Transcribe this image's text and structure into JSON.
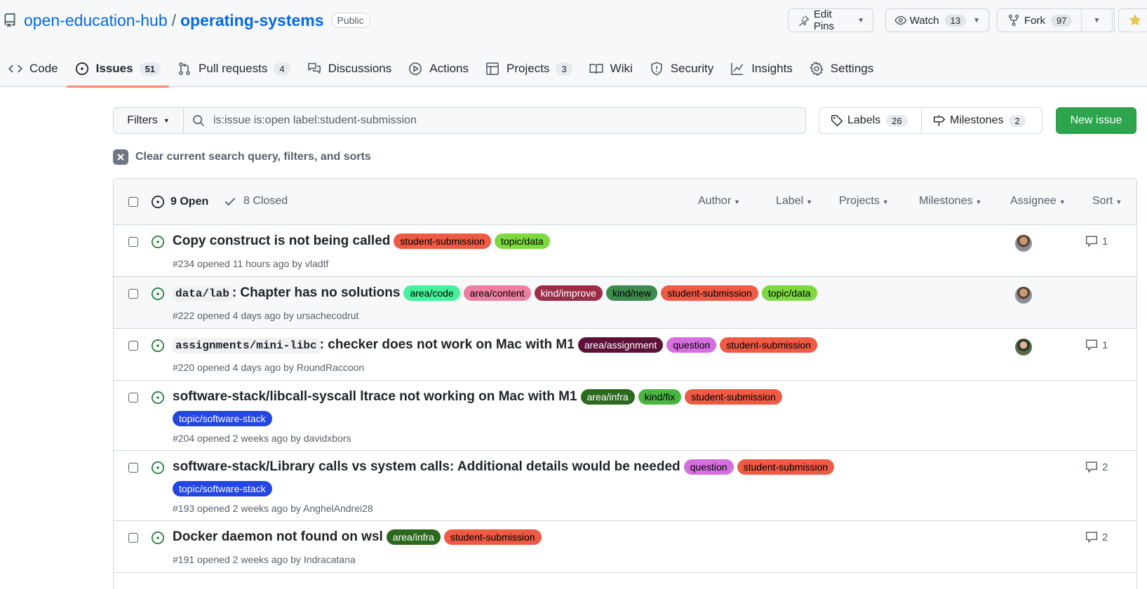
{
  "repo": {
    "owner": "open-education-hub",
    "separator": "/",
    "name": "operating-systems",
    "visibility": "Public"
  },
  "header_buttons": {
    "edit_pins": "Edit Pins",
    "watch": "Watch",
    "watch_count": "13",
    "fork": "Fork",
    "fork_count": "97"
  },
  "tabs": [
    {
      "label": "Code",
      "icon": "code-icon"
    },
    {
      "label": "Issues",
      "count": "51",
      "icon": "issue-opened-icon",
      "active": true
    },
    {
      "label": "Pull requests",
      "count": "4",
      "icon": "git-pull-request-icon"
    },
    {
      "label": "Discussions",
      "icon": "comment-discussion-icon"
    },
    {
      "label": "Actions",
      "icon": "play-icon"
    },
    {
      "label": "Projects",
      "count": "3",
      "icon": "table-icon"
    },
    {
      "label": "Wiki",
      "icon": "book-icon"
    },
    {
      "label": "Security",
      "icon": "shield-icon"
    },
    {
      "label": "Insights",
      "icon": "graph-icon"
    },
    {
      "label": "Settings",
      "icon": "gear-icon"
    }
  ],
  "filter_bar": {
    "filters_label": "Filters",
    "search_value": "is:issue is:open label:student-submission",
    "labels_label": "Labels",
    "labels_count": "26",
    "milestones_label": "Milestones",
    "milestones_count": "2",
    "new_issue_label": "New issue"
  },
  "clear_query": "Clear current search query, filters, and sorts",
  "list_header": {
    "open_label": "9 Open",
    "closed_label": "8 Closed",
    "filters": [
      "Author",
      "Label",
      "Projects",
      "Milestones",
      "Assignee",
      "Sort"
    ]
  },
  "issues": [
    {
      "title_code": "",
      "title": "Copy construct is not being called",
      "labels": [
        {
          "name": "student-submission",
          "bg": "#ee5a44",
          "fg": "#000000"
        },
        {
          "name": "topic/data",
          "bg": "#7ed941",
          "fg": "#000000"
        }
      ],
      "meta": "#234 opened 11 hours ago by vladtf",
      "comments": "1",
      "has_avatar": true
    },
    {
      "title_code": "data/lab",
      "title": ": Chapter has no solutions",
      "labels": [
        {
          "name": "area/code",
          "bg": "#45f29b",
          "fg": "#000000"
        },
        {
          "name": "area/content",
          "bg": "#ee7fa0",
          "fg": "#000000"
        },
        {
          "name": "kind/improve",
          "bg": "#9b2d49",
          "fg": "#ffffff"
        },
        {
          "name": "kind/new",
          "bg": "#3c8a4c",
          "fg": "#000000"
        },
        {
          "name": "student-submission",
          "bg": "#ee5a44",
          "fg": "#000000"
        },
        {
          "name": "topic/data",
          "bg": "#7ed941",
          "fg": "#000000"
        }
      ],
      "meta": "#222 opened 4 days ago by ursachecodrut",
      "comments": "",
      "has_avatar": true
    },
    {
      "title_code": "assignments/mini-libc",
      "title": ": checker does not work on Mac with M1",
      "labels": [
        {
          "name": "area/assignment",
          "bg": "#5c1139",
          "fg": "#ffffff"
        },
        {
          "name": "question",
          "bg": "#d66ee0",
          "fg": "#000000"
        },
        {
          "name": "student-submission",
          "bg": "#ee5a44",
          "fg": "#000000"
        }
      ],
      "meta": "#220 opened 4 days ago by RoundRaccoon",
      "comments": "1",
      "has_avatar": true
    },
    {
      "title_code": "",
      "title": "software-stack/libcall-syscall ltrace not working on Mac with M1",
      "labels": [
        {
          "name": "area/infra",
          "bg": "#2b6a1e",
          "fg": "#ffffff"
        },
        {
          "name": "kind/fix",
          "bg": "#49b642",
          "fg": "#000000"
        },
        {
          "name": "student-submission",
          "bg": "#ee5a44",
          "fg": "#000000"
        }
      ],
      "wrap_labels": [
        {
          "name": "topic/software-stack",
          "bg": "#2446e2",
          "fg": "#ffffff"
        }
      ],
      "meta": "#204 opened 2 weeks ago by davidxbors",
      "comments": "",
      "has_avatar": false
    },
    {
      "title_code": "",
      "title": "software-stack/Library calls vs system calls: Additional details would be needed",
      "labels": [
        {
          "name": "question",
          "bg": "#d66ee0",
          "fg": "#000000"
        },
        {
          "name": "student-submission",
          "bg": "#ee5a44",
          "fg": "#000000"
        }
      ],
      "wrap_labels": [
        {
          "name": "topic/software-stack",
          "bg": "#2446e2",
          "fg": "#ffffff"
        }
      ],
      "meta": "#193 opened 2 weeks ago by AnghelAndrei28",
      "comments": "2",
      "has_avatar": false
    },
    {
      "title_code": "",
      "title": "Docker daemon not found on wsl",
      "labels": [
        {
          "name": "area/infra",
          "bg": "#2b6a1e",
          "fg": "#ffffff"
        },
        {
          "name": "student-submission",
          "bg": "#ee5a44",
          "fg": "#000000"
        }
      ],
      "meta": "#191 opened 2 weeks ago by Indracatana",
      "comments": "2",
      "has_avatar": false
    }
  ],
  "colors": {
    "accent_link": "#0969da",
    "open_icon": "#1a7f37",
    "new_issue_bg": "#2da44e",
    "active_tab_underline": "#fd8c73"
  }
}
